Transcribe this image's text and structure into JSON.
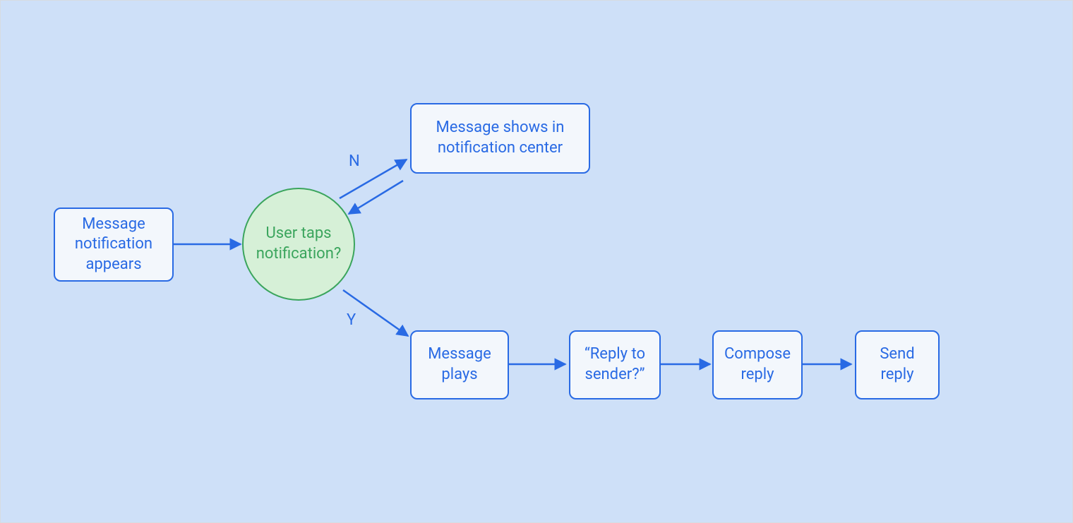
{
  "nodes": {
    "start": "Message notification appears",
    "decision": "User taps notification?",
    "no_branch": "Message shows in notification center",
    "yes1": "Message plays",
    "yes2": "“Reply to sender?”",
    "yes3": "Compose reply",
    "yes4": "Send reply"
  },
  "labels": {
    "no": "N",
    "yes": "Y"
  },
  "colors": {
    "bg": "#cee0f8",
    "rect_border": "#296ae4",
    "rect_fill": "#f3f7fc",
    "rect_text": "#296ae4",
    "circle_border": "#3ba55d",
    "circle_fill": "#d6f0d7",
    "circle_text": "#3ba55d",
    "arrow": "#296ae4"
  },
  "chart_data": {
    "type": "flowchart",
    "nodes": [
      {
        "id": "start",
        "shape": "rect",
        "label": "Message notification appears"
      },
      {
        "id": "decision",
        "shape": "circle",
        "label": "User taps notification?"
      },
      {
        "id": "no_branch",
        "shape": "rect",
        "label": "Message shows in notification center"
      },
      {
        "id": "yes1",
        "shape": "rect",
        "label": "Message plays"
      },
      {
        "id": "yes2",
        "shape": "rect",
        "label": "“Reply to sender?”"
      },
      {
        "id": "yes3",
        "shape": "rect",
        "label": "Compose reply"
      },
      {
        "id": "yes4",
        "shape": "rect",
        "label": "Send reply"
      }
    ],
    "edges": [
      {
        "from": "start",
        "to": "decision",
        "label": null
      },
      {
        "from": "decision",
        "to": "no_branch",
        "label": "N"
      },
      {
        "from": "no_branch",
        "to": "decision",
        "label": null
      },
      {
        "from": "decision",
        "to": "yes1",
        "label": "Y"
      },
      {
        "from": "yes1",
        "to": "yes2",
        "label": null
      },
      {
        "from": "yes2",
        "to": "yes3",
        "label": null
      },
      {
        "from": "yes3",
        "to": "yes4",
        "label": null
      }
    ]
  }
}
